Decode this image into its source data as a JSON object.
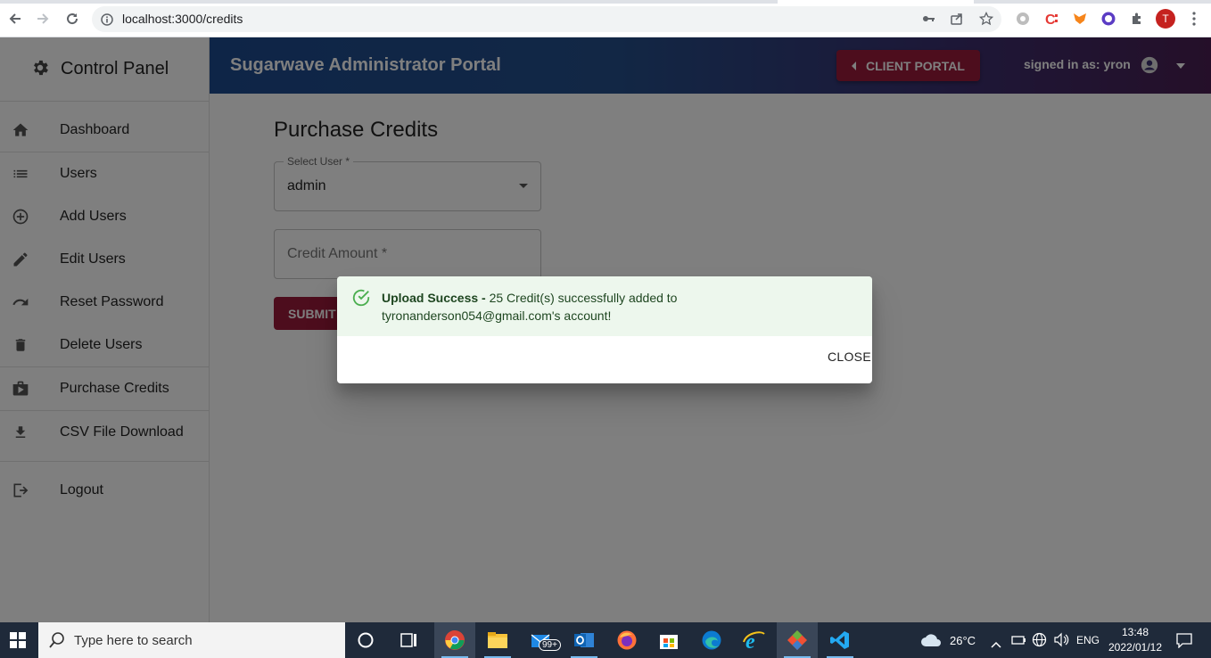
{
  "browser": {
    "url": "localhost:3000/credits",
    "profile_initial": "T"
  },
  "sidebar": {
    "brand": "Control Panel",
    "items": [
      {
        "label": "Dashboard",
        "icon": "home-icon"
      },
      {
        "label": "Users",
        "icon": "list-icon"
      },
      {
        "label": "Add Users",
        "icon": "add-circle-icon"
      },
      {
        "label": "Edit Users",
        "icon": "pencil-icon"
      },
      {
        "label": "Reset Password",
        "icon": "redo-icon"
      },
      {
        "label": "Delete Users",
        "icon": "trash-icon"
      },
      {
        "label": "Purchase Credits",
        "icon": "shop-icon"
      },
      {
        "label": "CSV File Download",
        "icon": "download-icon"
      },
      {
        "label": "Logout",
        "icon": "logout-icon"
      }
    ]
  },
  "header": {
    "title": "Sugarwave Administrator Portal",
    "client_portal": "CLIENT PORTAL",
    "signed_in": "signed in as: yron"
  },
  "main": {
    "title": "Purchase Credits",
    "select_user_label": "Select User *",
    "select_user_value": "admin",
    "credit_amount_placeholder": "Credit Amount *",
    "submit": "SUBMIT"
  },
  "dialog": {
    "title": "Upload Success -",
    "message": "25 Credit(s) successfully added to tyronanderson054@gmail.com's account!",
    "close": "CLOSE"
  },
  "taskbar": {
    "search_placeholder": "Type here to search",
    "mail_badge": "99+",
    "weather": "26°C",
    "language": "ENG",
    "time": "13:48",
    "date": "2022/01/12"
  },
  "colors": {
    "accent": "#9b1b3a",
    "success_bg": "#edf7ed",
    "success_icon": "#4caf50"
  }
}
